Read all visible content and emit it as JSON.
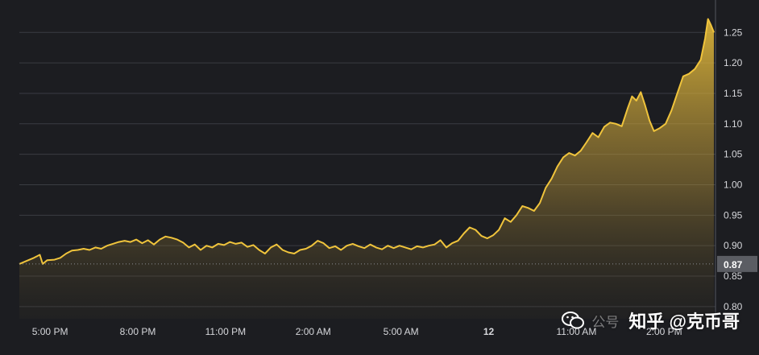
{
  "chart_data": {
    "type": "area",
    "y_ticks": [
      "1.25",
      "1.20",
      "1.15",
      "1.10",
      "1.05",
      "1.00",
      "0.95",
      "0.90",
      "0.85",
      "0.80"
    ],
    "y_tick_values": [
      1.25,
      1.2,
      1.15,
      1.1,
      1.05,
      1.0,
      0.95,
      0.9,
      0.85,
      0.8
    ],
    "ylim": [
      0.78,
      1.29
    ],
    "x_ticks": [
      {
        "label": "5:00 PM",
        "t": 0.35,
        "bold": false
      },
      {
        "label": "8:00 PM",
        "t": 3.35,
        "bold": false
      },
      {
        "label": "11:00 PM",
        "t": 6.35,
        "bold": false
      },
      {
        "label": "2:00 AM",
        "t": 9.35,
        "bold": false
      },
      {
        "label": "5:00 AM",
        "t": 12.35,
        "bold": false
      },
      {
        "label": "12",
        "t": 15.35,
        "bold": true
      },
      {
        "label": "11:00 AM",
        "t": 18.35,
        "bold": false
      },
      {
        "label": "2:00 PM",
        "t": 21.35,
        "bold": false
      }
    ],
    "xlim": [
      -0.7,
      23.05
    ],
    "current_value": "0.87",
    "current_value_level": 0.87,
    "line_color": "#f0c43c",
    "points": [
      [
        -0.7,
        0.87
      ],
      [
        -0.45,
        0.875
      ],
      [
        -0.2,
        0.88
      ],
      [
        0.0,
        0.885
      ],
      [
        0.1,
        0.87
      ],
      [
        0.25,
        0.876
      ],
      [
        0.5,
        0.877
      ],
      [
        0.7,
        0.88
      ],
      [
        0.9,
        0.887
      ],
      [
        1.1,
        0.892
      ],
      [
        1.3,
        0.893
      ],
      [
        1.5,
        0.895
      ],
      [
        1.7,
        0.893
      ],
      [
        1.9,
        0.897
      ],
      [
        2.1,
        0.895
      ],
      [
        2.3,
        0.9
      ],
      [
        2.5,
        0.903
      ],
      [
        2.7,
        0.906
      ],
      [
        2.9,
        0.908
      ],
      [
        3.1,
        0.906
      ],
      [
        3.3,
        0.91
      ],
      [
        3.5,
        0.904
      ],
      [
        3.7,
        0.909
      ],
      [
        3.9,
        0.902
      ],
      [
        4.1,
        0.91
      ],
      [
        4.3,
        0.915
      ],
      [
        4.5,
        0.913
      ],
      [
        4.7,
        0.91
      ],
      [
        4.9,
        0.905
      ],
      [
        5.1,
        0.897
      ],
      [
        5.3,
        0.902
      ],
      [
        5.5,
        0.893
      ],
      [
        5.7,
        0.9
      ],
      [
        5.9,
        0.897
      ],
      [
        6.1,
        0.903
      ],
      [
        6.3,
        0.901
      ],
      [
        6.5,
        0.906
      ],
      [
        6.7,
        0.903
      ],
      [
        6.9,
        0.905
      ],
      [
        7.1,
        0.898
      ],
      [
        7.3,
        0.901
      ],
      [
        7.5,
        0.893
      ],
      [
        7.7,
        0.887
      ],
      [
        7.9,
        0.897
      ],
      [
        8.1,
        0.902
      ],
      [
        8.3,
        0.893
      ],
      [
        8.5,
        0.889
      ],
      [
        8.7,
        0.887
      ],
      [
        8.9,
        0.893
      ],
      [
        9.1,
        0.895
      ],
      [
        9.3,
        0.9
      ],
      [
        9.5,
        0.908
      ],
      [
        9.7,
        0.904
      ],
      [
        9.9,
        0.896
      ],
      [
        10.1,
        0.899
      ],
      [
        10.3,
        0.893
      ],
      [
        10.5,
        0.9
      ],
      [
        10.7,
        0.903
      ],
      [
        10.9,
        0.899
      ],
      [
        11.1,
        0.896
      ],
      [
        11.3,
        0.902
      ],
      [
        11.5,
        0.897
      ],
      [
        11.7,
        0.894
      ],
      [
        11.9,
        0.9
      ],
      [
        12.1,
        0.896
      ],
      [
        12.3,
        0.9
      ],
      [
        12.5,
        0.897
      ],
      [
        12.7,
        0.894
      ],
      [
        12.9,
        0.899
      ],
      [
        13.1,
        0.897
      ],
      [
        13.3,
        0.9
      ],
      [
        13.5,
        0.902
      ],
      [
        13.7,
        0.909
      ],
      [
        13.9,
        0.897
      ],
      [
        14.1,
        0.904
      ],
      [
        14.3,
        0.908
      ],
      [
        14.5,
        0.92
      ],
      [
        14.7,
        0.93
      ],
      [
        14.9,
        0.926
      ],
      [
        15.1,
        0.916
      ],
      [
        15.3,
        0.912
      ],
      [
        15.5,
        0.917
      ],
      [
        15.7,
        0.926
      ],
      [
        15.9,
        0.945
      ],
      [
        16.1,
        0.939
      ],
      [
        16.3,
        0.95
      ],
      [
        16.5,
        0.965
      ],
      [
        16.7,
        0.962
      ],
      [
        16.9,
        0.957
      ],
      [
        17.1,
        0.97
      ],
      [
        17.3,
        0.995
      ],
      [
        17.5,
        1.01
      ],
      [
        17.7,
        1.03
      ],
      [
        17.9,
        1.045
      ],
      [
        18.1,
        1.052
      ],
      [
        18.3,
        1.048
      ],
      [
        18.5,
        1.056
      ],
      [
        18.7,
        1.07
      ],
      [
        18.9,
        1.085
      ],
      [
        19.1,
        1.078
      ],
      [
        19.3,
        1.095
      ],
      [
        19.5,
        1.102
      ],
      [
        19.7,
        1.1
      ],
      [
        19.9,
        1.096
      ],
      [
        20.1,
        1.125
      ],
      [
        20.25,
        1.145
      ],
      [
        20.4,
        1.138
      ],
      [
        20.55,
        1.152
      ],
      [
        20.7,
        1.13
      ],
      [
        20.85,
        1.105
      ],
      [
        21.0,
        1.088
      ],
      [
        21.2,
        1.093
      ],
      [
        21.4,
        1.1
      ],
      [
        21.6,
        1.122
      ],
      [
        21.8,
        1.15
      ],
      [
        22.0,
        1.178
      ],
      [
        22.2,
        1.182
      ],
      [
        22.4,
        1.19
      ],
      [
        22.6,
        1.205
      ],
      [
        22.75,
        1.24
      ],
      [
        22.85,
        1.272
      ],
      [
        22.95,
        1.262
      ],
      [
        23.05,
        1.25
      ]
    ]
  },
  "watermark": {
    "text": "知乎 @克币哥",
    "sub_text": "公号"
  }
}
